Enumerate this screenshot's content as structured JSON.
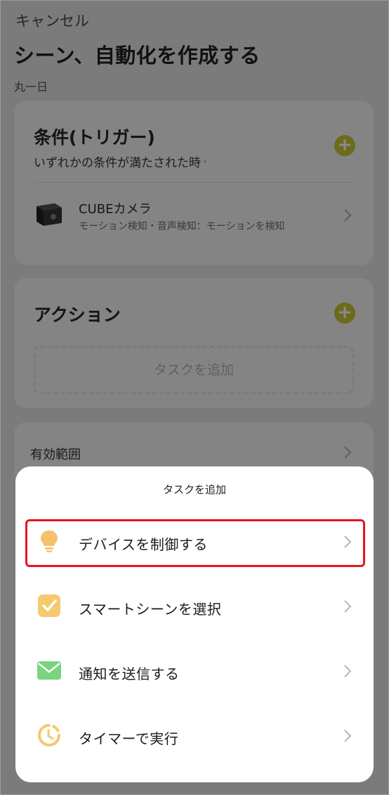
{
  "header": {
    "cancel_label": "キャンセル",
    "title": "シーン、自動化を作成する",
    "schedule": "丸一日"
  },
  "conditions": {
    "heading": "条件(トリガー)",
    "match_mode": "いずれかの条件が満たされた時",
    "match_caret": "˅",
    "device": {
      "name": "CUBEカメラ",
      "description": "モーション検知・音声検知：モーションを検知"
    }
  },
  "actions": {
    "heading": "アクション",
    "add_task_placeholder": "タスクを追加"
  },
  "scope": {
    "label": "有効範囲"
  },
  "sheet": {
    "title": "タスクを追加",
    "items": [
      {
        "label": "デバイスを制御する",
        "icon": "lightbulb-icon",
        "highlighted": true
      },
      {
        "label": "スマートシーンを選択",
        "icon": "checkbox-icon"
      },
      {
        "label": "通知を送信する",
        "icon": "envelope-icon"
      },
      {
        "label": "タイマーで実行",
        "icon": "timer-icon"
      }
    ]
  },
  "colors": {
    "highlight": "#e8141c",
    "bulb": "#f5c16c",
    "check": "#f5c96e",
    "mail": "#79d47e",
    "timer": "#f5c96e",
    "add_button": "#6d6a1c"
  }
}
